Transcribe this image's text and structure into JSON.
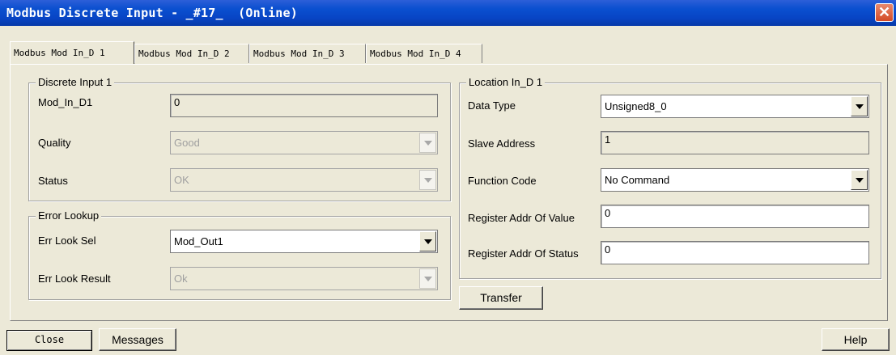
{
  "window": {
    "title": "Modbus Discrete Input - _#17_  (Online)",
    "close_symbol": "✕"
  },
  "tabs": [
    {
      "label": "Modbus Mod In_D 1",
      "active": true
    },
    {
      "label": "Modbus Mod In_D 2",
      "active": false
    },
    {
      "label": "Modbus Mod In_D 3",
      "active": false
    },
    {
      "label": "Modbus Mod In_D 4",
      "active": false
    }
  ],
  "discrete_input": {
    "group_title": "Discrete Input 1",
    "mod_in_label": "Mod_In_D1",
    "mod_in_value": "0",
    "quality_label": "Quality",
    "quality_value": "Good",
    "status_label": "Status",
    "status_value": "OK"
  },
  "error_lookup": {
    "group_title": "Error Lookup",
    "sel_label": "Err Look Sel",
    "sel_value": "Mod_Out1",
    "result_label": "Err Look Result",
    "result_value": "Ok"
  },
  "location": {
    "group_title": "Location In_D 1",
    "data_type_label": "Data Type",
    "data_type_value": "Unsigned8_0",
    "slave_address_label": "Slave Address",
    "slave_address_value": "1",
    "function_code_label": "Function Code",
    "function_code_value": "No Command",
    "reg_value_label": "Register Addr Of Value",
    "reg_value_value": "0",
    "reg_status_label": "Register Addr Of Status",
    "reg_status_value": "0"
  },
  "buttons": {
    "transfer": "Transfer",
    "close": "Close",
    "messages": "Messages",
    "help": "Help"
  },
  "icons": {
    "close": "close-icon",
    "dropdown": "chevron-down-icon"
  }
}
